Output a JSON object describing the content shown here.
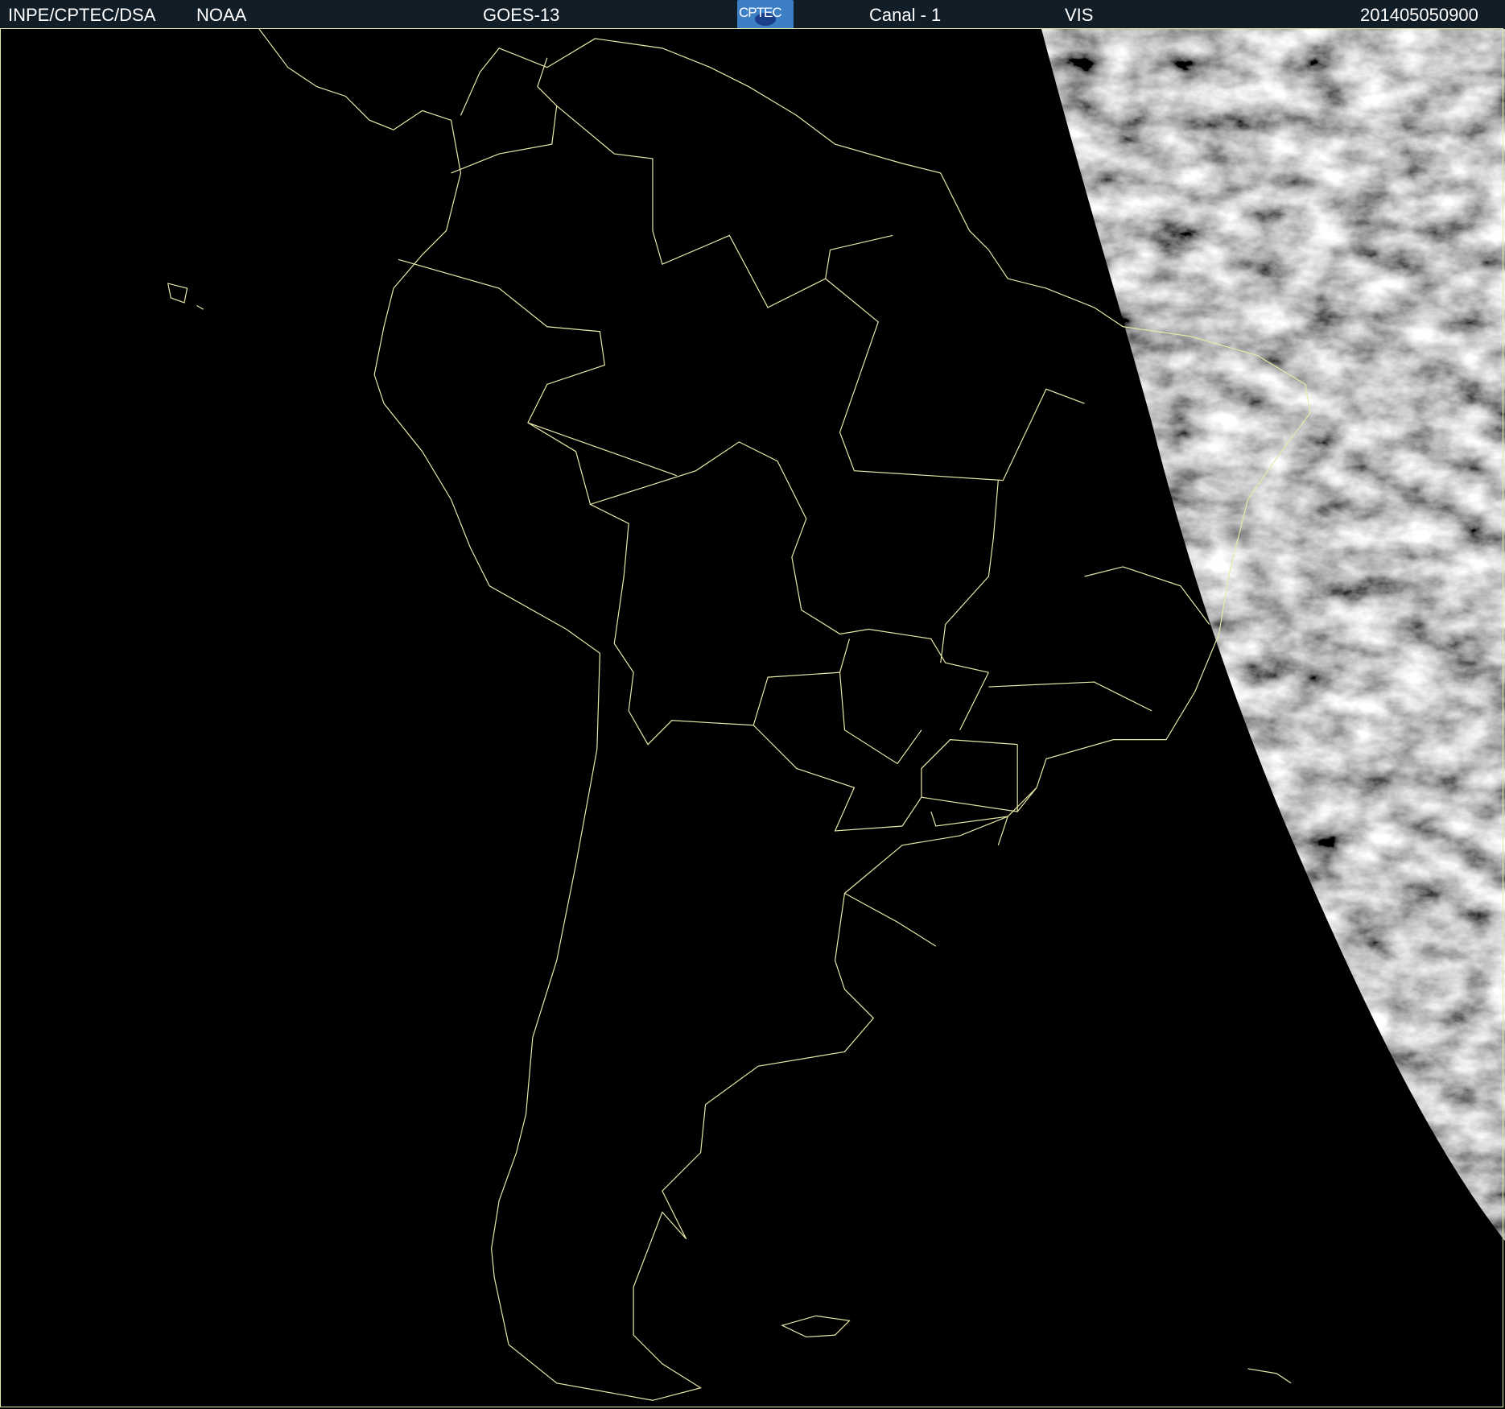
{
  "header": {
    "agency": "INPE/CPTEC/DSA",
    "source": "NOAA",
    "satellite": "GOES-13",
    "logo_text": "CPTEC",
    "channel": "Canal - 1",
    "band": "VIS",
    "timestamp": "201405050900"
  },
  "colors": {
    "header_bg": "#111d27",
    "borders": "#e8e8a8",
    "space": "#000000"
  }
}
